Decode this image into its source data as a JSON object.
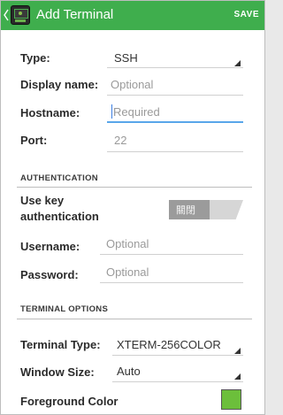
{
  "app": {
    "title": "Add Terminal",
    "save_label": "SAVE"
  },
  "fields": {
    "type": {
      "label": "Type:",
      "value": "SSH"
    },
    "display_name": {
      "label": "Display name:",
      "placeholder": "Optional"
    },
    "hostname": {
      "label": "Hostname:",
      "placeholder": "Required"
    },
    "port": {
      "label": "Port:",
      "value": "22"
    }
  },
  "authentication": {
    "section_title": "AUTHENTICATION",
    "use_key_label_line1": "Use key",
    "use_key_label_line2": "authentication",
    "toggle_text": "關閉",
    "username": {
      "label": "Username:",
      "placeholder": "Optional"
    },
    "password": {
      "label": "Password:",
      "placeholder": "Optional"
    }
  },
  "terminal_options": {
    "section_title": "TERMINAL OPTIONS",
    "terminal_type": {
      "label": "Terminal Type:",
      "value": "XTERM-256COLOR"
    },
    "window_size": {
      "label": "Window Size:",
      "value": "Auto"
    },
    "foreground_color": {
      "label": "Foreground Color",
      "color": "#6cbf3b"
    }
  },
  "colors": {
    "action_bar": "#3fae4d",
    "accent_focus": "#59a6ea"
  }
}
